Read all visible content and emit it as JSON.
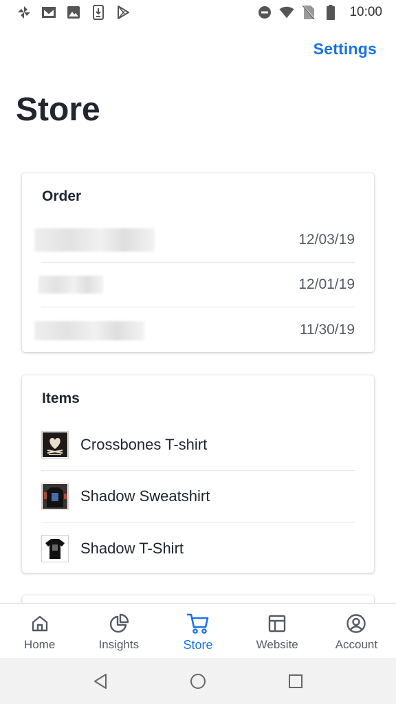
{
  "status_bar": {
    "time": "10:00",
    "left_icons": [
      "pinwheel-icon",
      "gmail-icon",
      "image-icon",
      "download-icon",
      "play-store-icon"
    ],
    "right_icons": [
      "do-not-disturb-icon",
      "wifi-icon",
      "no-sim-icon",
      "battery-icon"
    ]
  },
  "header": {
    "settings_label": "Settings",
    "title": "Store"
  },
  "orders": {
    "title": "Order",
    "rows": [
      {
        "date": "12/03/19"
      },
      {
        "date": "12/01/19"
      },
      {
        "date": "11/30/19"
      }
    ]
  },
  "items": {
    "title": "Items",
    "rows": [
      {
        "label": "Crossbones T-shirt"
      },
      {
        "label": "Shadow Sweatshirt"
      },
      {
        "label": "Shadow T-Shirt"
      }
    ]
  },
  "bottom_nav": {
    "items": [
      {
        "label": "Home",
        "icon": "home-icon",
        "active": false
      },
      {
        "label": "Insights",
        "icon": "pie-chart-icon",
        "active": false
      },
      {
        "label": "Store",
        "icon": "cart-icon",
        "active": true
      },
      {
        "label": "Website",
        "icon": "website-layout-icon",
        "active": false
      },
      {
        "label": "Account",
        "icon": "account-icon",
        "active": false
      }
    ]
  },
  "colors": {
    "accent": "#1a73e8",
    "text": "#1f2430",
    "muted": "#555a63",
    "nav_bar": "#f2f2f2"
  }
}
